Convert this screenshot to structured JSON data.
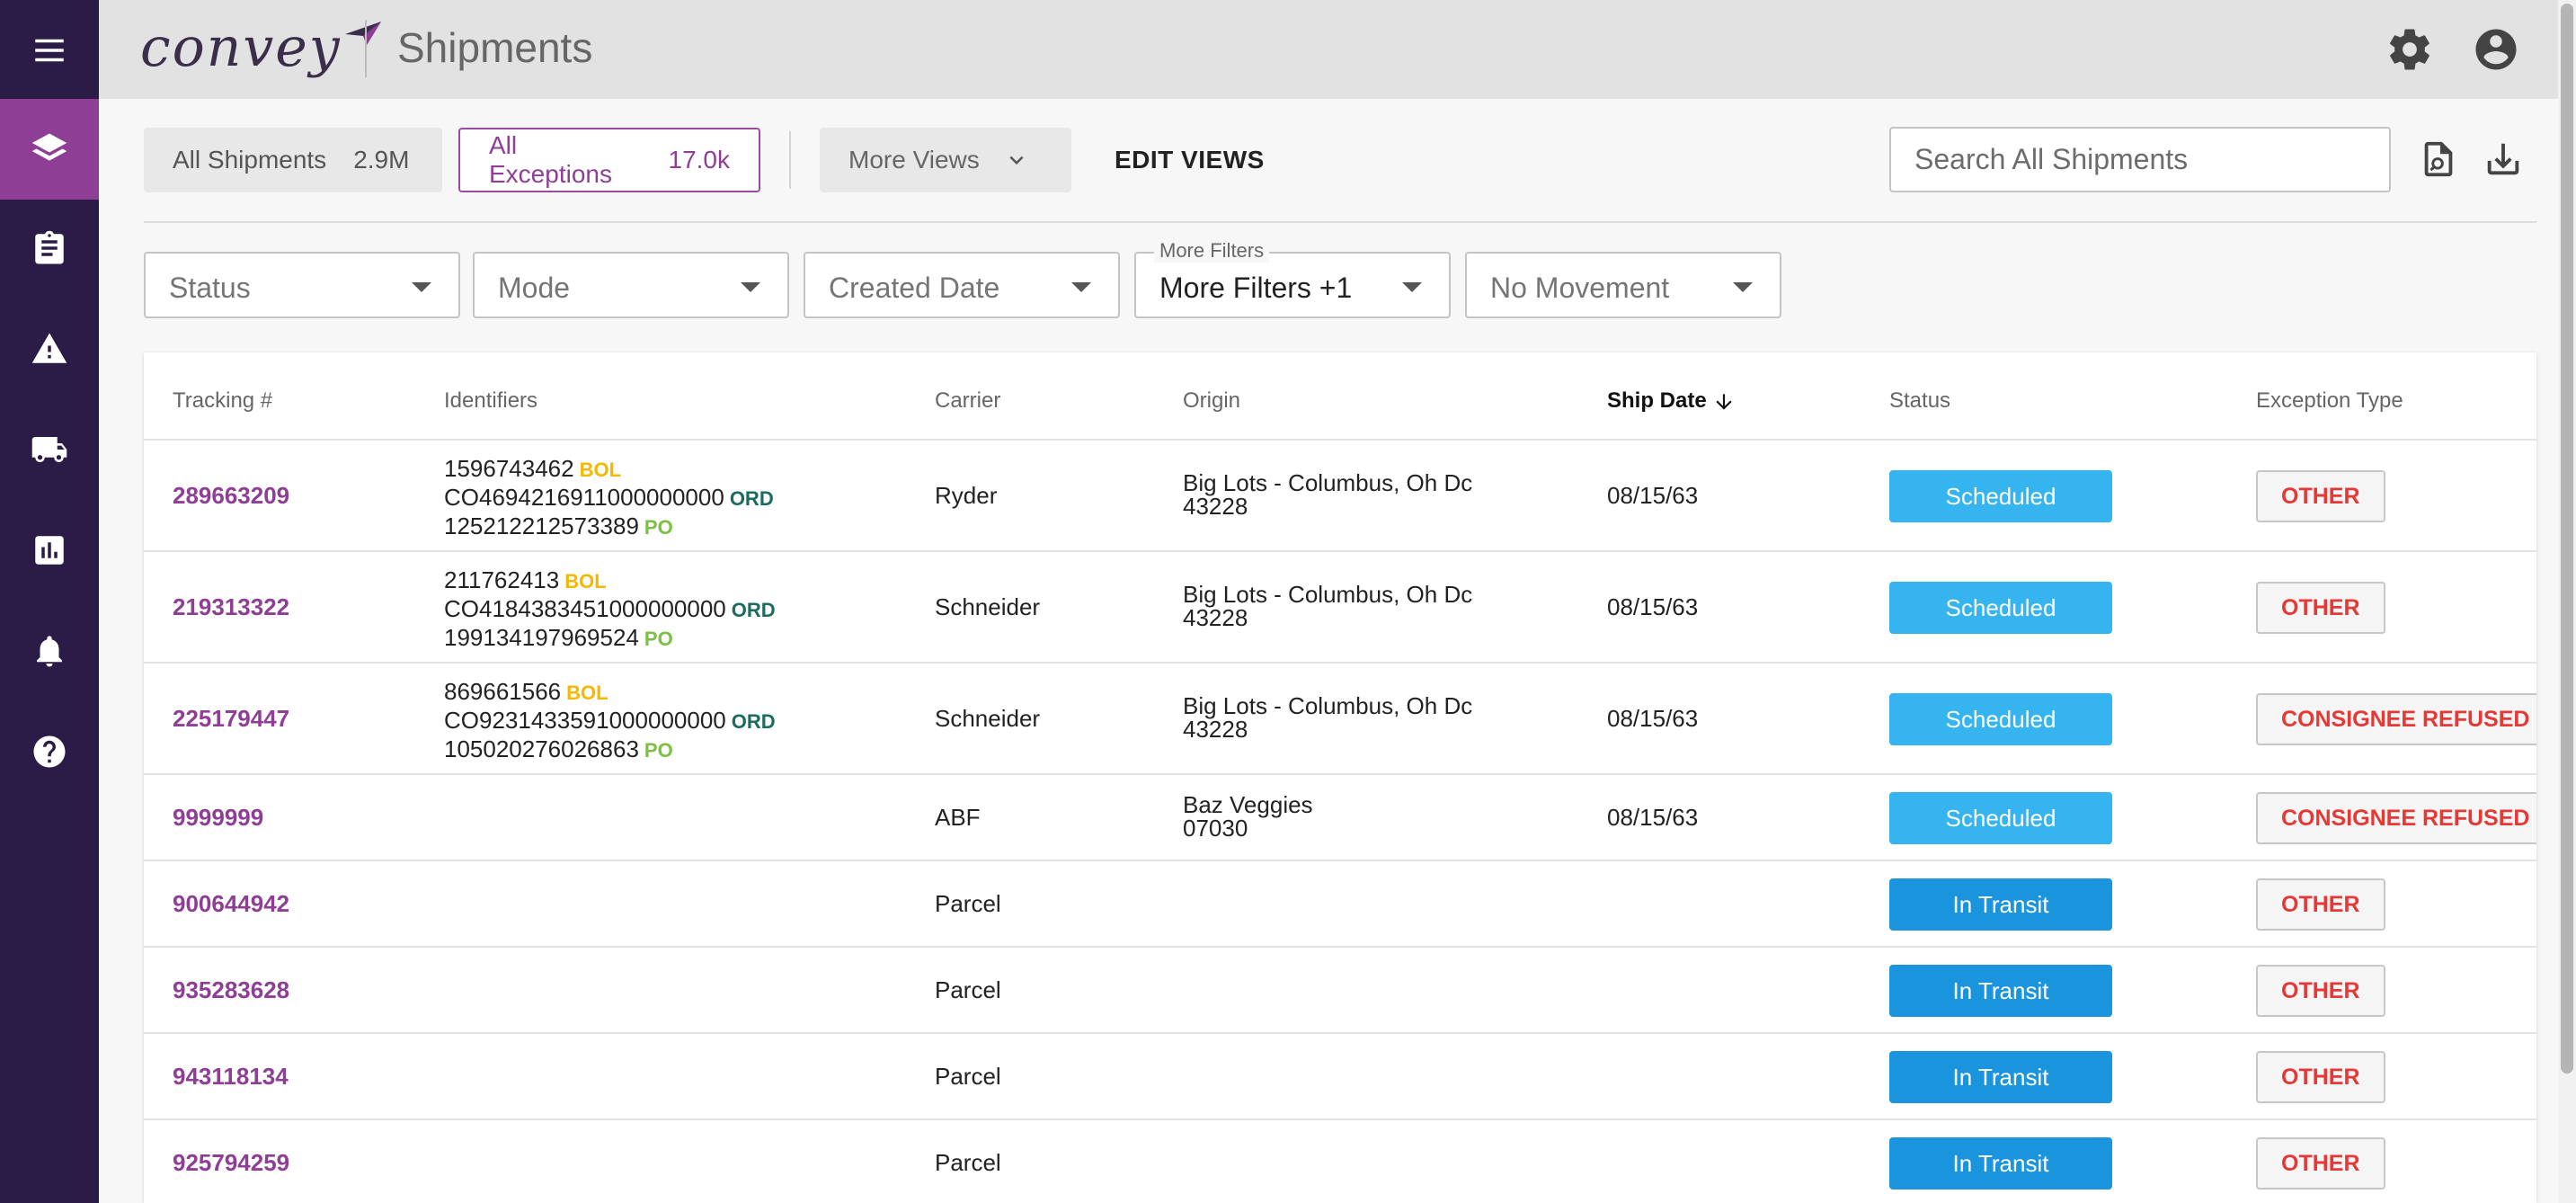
{
  "header": {
    "logo_text": "convey",
    "title": "Shipments"
  },
  "sidebar": {
    "items": [
      {
        "icon": "layers-icon",
        "active": true
      },
      {
        "icon": "clipboard-icon",
        "active": false
      },
      {
        "icon": "warning-icon",
        "active": false
      },
      {
        "icon": "truck-icon",
        "active": false
      },
      {
        "icon": "chart-icon",
        "active": false
      },
      {
        "icon": "bell-icon",
        "active": false
      },
      {
        "icon": "help-icon",
        "active": false
      }
    ]
  },
  "views": {
    "all_shipments": {
      "label": "All Shipments",
      "count": "2.9M"
    },
    "all_exceptions": {
      "label": "All Exceptions",
      "count": "17.0k"
    },
    "more_views": "More Views",
    "edit_views": "EDIT VIEWS"
  },
  "search": {
    "placeholder": "Search All Shipments",
    "value": ""
  },
  "filters": {
    "status": "Status",
    "mode": "Mode",
    "created_date": "Created Date",
    "more_filters_legend": "More Filters",
    "more_filters_value": "More Filters +1",
    "no_movement": "No Movement"
  },
  "table": {
    "columns": [
      "Tracking #",
      "Identifiers",
      "Carrier",
      "Origin",
      "Ship Date",
      "Status",
      "Exception Type"
    ],
    "rows": [
      {
        "tracking": "289663209",
        "bol": "1596743462",
        "ord": "CO4694216911000000000",
        "po": "125212212573389",
        "carrier": "Ryder",
        "origin1": "Big Lots - Columbus, Oh Dc",
        "origin2": "43228",
        "ship_date": "08/15/63",
        "status": "Scheduled",
        "exception": "OTHER"
      },
      {
        "tracking": "219313322",
        "bol": "211762413",
        "ord": "CO4184383451000000000",
        "po": "199134197969524",
        "carrier": "Schneider",
        "origin1": "Big Lots - Columbus, Oh Dc",
        "origin2": "43228",
        "ship_date": "08/15/63",
        "status": "Scheduled",
        "exception": "OTHER"
      },
      {
        "tracking": "225179447",
        "bol": "869661566",
        "ord": "CO9231433591000000000",
        "po": "105020276026863",
        "carrier": "Schneider",
        "origin1": "Big Lots - Columbus, Oh Dc",
        "origin2": "43228",
        "ship_date": "08/15/63",
        "status": "Scheduled",
        "exception": "CONSIGNEE REFUSED"
      },
      {
        "tracking": "9999999",
        "carrier": "ABF",
        "origin1": "Baz Veggies",
        "origin2": "07030",
        "ship_date": "08/15/63",
        "status": "Scheduled",
        "exception": "CONSIGNEE REFUSED"
      },
      {
        "tracking": "900644942",
        "carrier": "Parcel",
        "status": "In Transit",
        "exception": "OTHER"
      },
      {
        "tracking": "935283628",
        "carrier": "Parcel",
        "status": "In Transit",
        "exception": "OTHER"
      },
      {
        "tracking": "943118134",
        "carrier": "Parcel",
        "status": "In Transit",
        "exception": "OTHER"
      },
      {
        "tracking": "925794259",
        "carrier": "Parcel",
        "status": "In Transit",
        "exception": "OTHER"
      }
    ]
  },
  "id_tags": {
    "bol": "BOL",
    "ord": "ORD",
    "po": "PO"
  },
  "colors": {
    "sidebar_bg": "#2b1b47",
    "accent": "#8e3e95",
    "scheduled": "#35b4f0",
    "in_transit": "#1a94dd",
    "exception_text": "#e53935"
  }
}
